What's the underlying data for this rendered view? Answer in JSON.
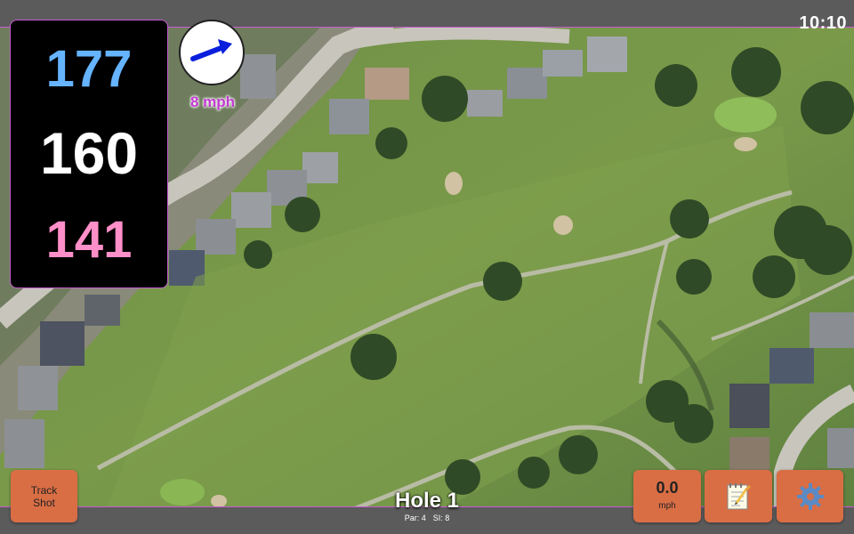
{
  "status_bar": {
    "time": "10:10"
  },
  "distances": {
    "back": "177",
    "center": "160",
    "front": "141"
  },
  "wind": {
    "speed_label": "8 mph",
    "direction_icon": "arrow-right-icon"
  },
  "buttons": {
    "track_shot": {
      "line1": "Track",
      "line2": "Shot"
    },
    "wind_reading": {
      "value": "0.0",
      "unit": "mph"
    },
    "notes_icon": "notepad-icon",
    "settings_icon": "gear-icon"
  },
  "hole": {
    "title": "Hole 1",
    "par": "Par: 4",
    "si": "SI: 8"
  },
  "colors": {
    "back_distance": "#66b3ff",
    "center_distance": "#ffffff",
    "front_distance": "#ff8fc8",
    "button_bg": "#d96e45",
    "accent_border": "#c55ad0",
    "bar_bg": "#5b5b5b"
  }
}
